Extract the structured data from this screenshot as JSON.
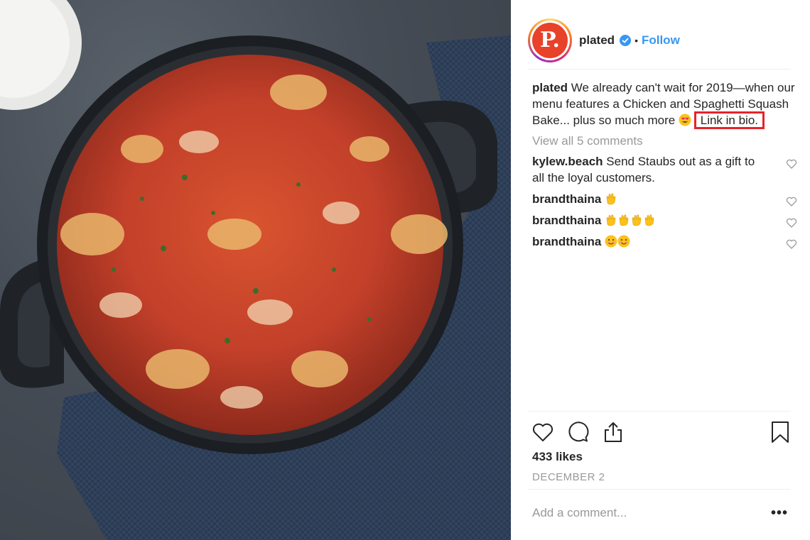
{
  "post": {
    "image_alt": "Chicken and Spaghetti Squash Bake in a cast-iron pan",
    "account": {
      "username": "plated",
      "verified": true,
      "follow_label": "Follow",
      "separator": "•",
      "avatar_letter": "P."
    },
    "caption": {
      "username": "plated",
      "text": "We already can't wait for 2019—when our menu features a Chicken and Spaghetti Squash Bake... plus so much more",
      "emoji": "heart-eyes-emoji",
      "link_text": "Link in bio."
    },
    "view_all_label": "View all 5 comments",
    "comments": [
      {
        "username": "kylew.beach",
        "text": "Send Staubs out as a gift to all the loyal customers.",
        "emojis": []
      },
      {
        "username": "brandthaina",
        "text": "",
        "emojis": [
          "clapping-hands-emoji"
        ]
      },
      {
        "username": "brandthaina",
        "text": "",
        "emojis": [
          "clapping-hands-emoji",
          "clapping-hands-emoji",
          "clapping-hands-emoji",
          "clapping-hands-emoji"
        ]
      },
      {
        "username": "brandthaina",
        "text": "",
        "emojis": [
          "smiling-face-emoji",
          "smiling-face-emoji"
        ]
      }
    ],
    "likes_label": "433 likes",
    "date_label": "DECEMBER 2",
    "add_comment_placeholder": "Add a comment...",
    "more_label": "•••",
    "icons": {
      "like": "heart-icon",
      "comment": "comment-bubble-icon",
      "share": "share-icon",
      "save": "bookmark-icon"
    },
    "colors": {
      "link": "#3897f0",
      "highlight_box": "#e5242b",
      "muted": "#999999",
      "text": "#262626"
    }
  }
}
